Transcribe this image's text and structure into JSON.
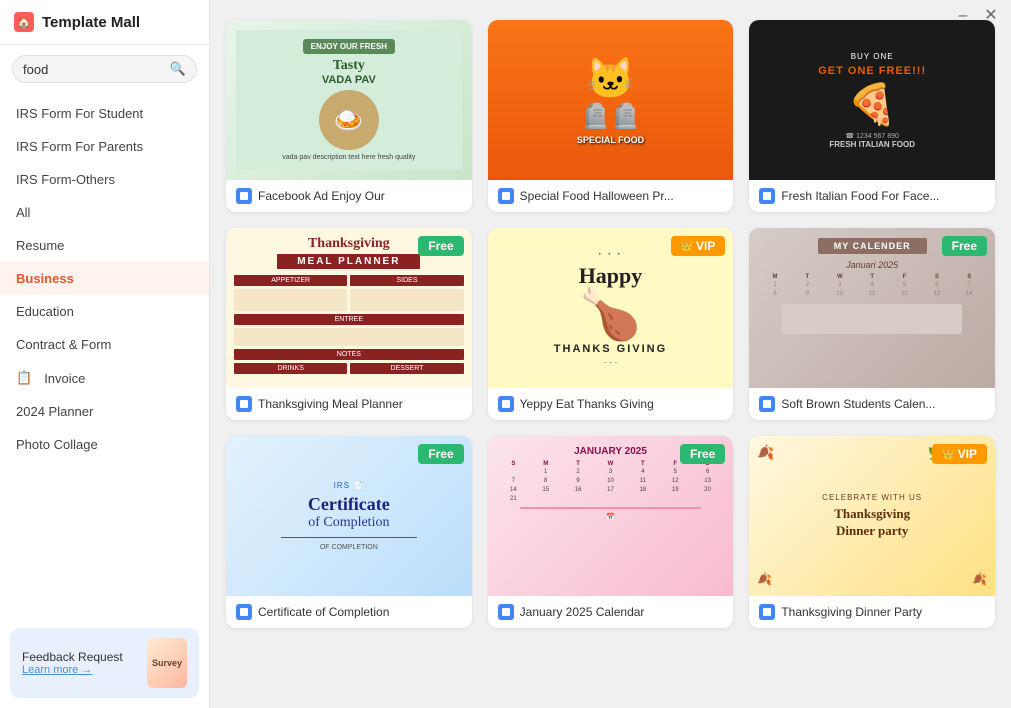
{
  "app": {
    "title": "Template Mall",
    "logo_alt": "home-icon"
  },
  "search": {
    "value": "food",
    "placeholder": "food"
  },
  "sidebar": {
    "nav_items": [
      {
        "id": "irs-student",
        "label": "IRS Form For Student",
        "active": false
      },
      {
        "id": "irs-parents",
        "label": "IRS Form For Parents",
        "active": false
      },
      {
        "id": "irs-others",
        "label": "IRS Form-Others",
        "active": false
      },
      {
        "id": "all",
        "label": "All",
        "active": false
      },
      {
        "id": "resume",
        "label": "Resume",
        "active": false
      },
      {
        "id": "business",
        "label": "Business",
        "active": true
      },
      {
        "id": "education",
        "label": "Education",
        "active": false
      },
      {
        "id": "contract-form",
        "label": "Contract & Form",
        "active": false
      },
      {
        "id": "invoice",
        "label": "Invoice",
        "active": false
      },
      {
        "id": "planner",
        "label": "2024 Planner",
        "active": false
      },
      {
        "id": "photo-collage",
        "label": "Photo Collage",
        "active": false
      }
    ],
    "invoice_icon": "invoice-icon",
    "footer": {
      "title": "Feedback Request",
      "link_text": "Learn more →",
      "survey_label": "Survey"
    }
  },
  "cards": [
    {
      "id": "facebook-ad",
      "label": "Facebook Ad Enjoy Our",
      "badge": null,
      "mock_type": "facebook"
    },
    {
      "id": "halloween-food",
      "label": "Special Food Halloween Pr...",
      "badge": null,
      "mock_type": "halloween"
    },
    {
      "id": "italian-food",
      "label": "Fresh Italian Food For Face...",
      "badge": null,
      "mock_type": "italian"
    },
    {
      "id": "thanksgiving-meal",
      "label": "Thanksgiving Meal Planner",
      "badge": "Free",
      "badge_type": "free",
      "mock_type": "thanksgiving"
    },
    {
      "id": "yeppy-thanks",
      "label": "Yeppy Eat Thanks Giving",
      "badge": "VIP",
      "badge_type": "vip",
      "mock_type": "yeppy"
    },
    {
      "id": "soft-calendar",
      "label": "Soft Brown Students Calen...",
      "badge": "Free",
      "badge_type": "free",
      "mock_type": "calendar"
    },
    {
      "id": "certificate",
      "label": "Certificate of Completion",
      "badge": "Free",
      "badge_type": "free",
      "mock_type": "certificate"
    },
    {
      "id": "jan-calendar",
      "label": "January 2025 Calendar",
      "badge": "Free",
      "badge_type": "free",
      "mock_type": "jan_calendar"
    },
    {
      "id": "dinner-party",
      "label": "Thanksgiving Dinner Party",
      "badge": "VIP",
      "badge_type": "vip",
      "mock_type": "dinner"
    }
  ],
  "window": {
    "minimize_label": "–",
    "close_label": "✕"
  }
}
